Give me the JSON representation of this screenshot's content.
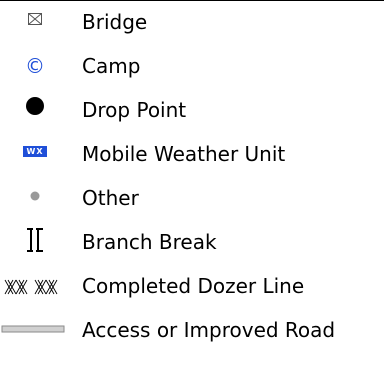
{
  "legend": {
    "items": [
      {
        "label": "Bridge",
        "icon": "bridge-icon"
      },
      {
        "label": "Camp",
        "icon": "camp-icon",
        "symbol": "©",
        "color": "#1f4fd8"
      },
      {
        "label": "Drop Point",
        "icon": "drop-point-icon",
        "color": "#000000"
      },
      {
        "label": "Mobile Weather Unit",
        "icon": "mobile-weather-unit-icon",
        "symbol": "WX",
        "color": "#1f4fd8"
      },
      {
        "label": "Other",
        "icon": "other-icon",
        "color": "#9a9a9a"
      },
      {
        "label": "Branch Break",
        "icon": "branch-break-icon",
        "color": "#000000"
      },
      {
        "label": "Completed Dozer Line",
        "icon": "completed-dozer-line-icon",
        "color": "#000000"
      },
      {
        "label": "Access or Improved Road",
        "icon": "access-road-icon",
        "color": "#b0b0b0"
      }
    ]
  }
}
